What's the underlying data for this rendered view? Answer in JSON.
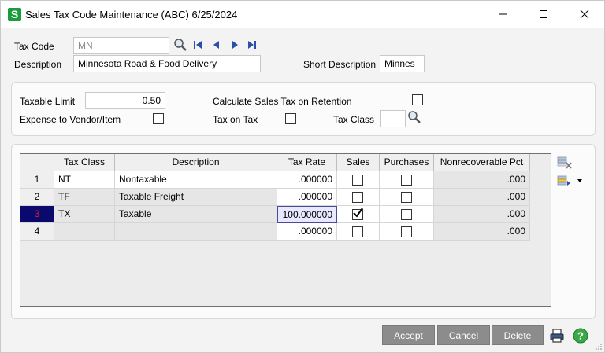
{
  "window": {
    "app_icon_letter": "S",
    "title": "Sales Tax Code Maintenance (ABC) 6/25/2024"
  },
  "header": {
    "tax_code_label": "Tax Code",
    "tax_code_value": "MN",
    "description_label": "Description",
    "description_value": "Minnesota Road & Food Delivery",
    "short_description_label": "Short Description",
    "short_description_value": "Minnes"
  },
  "options": {
    "taxable_limit_label": "Taxable Limit",
    "taxable_limit_value": "0.50",
    "calc_on_retention_label": "Calculate Sales Tax on Retention",
    "expense_to_vendor_label": "Expense to Vendor/Item",
    "tax_on_tax_label": "Tax on Tax",
    "tax_class_label": "Tax Class",
    "tax_class_value": ""
  },
  "grid": {
    "columns": [
      "Tax Class",
      "Description",
      "Tax Rate",
      "Sales",
      "Purchases",
      "Nonrecoverable Pct"
    ],
    "rows": [
      {
        "num": "1",
        "tax_class": "NT",
        "description": "Nontaxable",
        "tax_rate": ".000000",
        "sales": false,
        "purchases": false,
        "nonrecoverable": ".000"
      },
      {
        "num": "2",
        "tax_class": "TF",
        "description": "Taxable Freight",
        "tax_rate": ".000000",
        "sales": false,
        "purchases": false,
        "nonrecoverable": ".000"
      },
      {
        "num": "3",
        "tax_class": "TX",
        "description": "Taxable",
        "tax_rate": "100.000000",
        "sales": true,
        "purchases": false,
        "nonrecoverable": ".000"
      },
      {
        "num": "4",
        "tax_class": "",
        "description": "",
        "tax_rate": ".000000",
        "sales": false,
        "purchases": false,
        "nonrecoverable": ".000"
      }
    ]
  },
  "buttons": {
    "accept_first": "A",
    "accept_rest": "ccept",
    "cancel_first": "C",
    "cancel_rest": "ancel",
    "delete_first": "D",
    "delete_rest": "elete"
  },
  "colors": {
    "accent_green": "#1a9c3a",
    "nav_blue": "#2b4fa8",
    "button_gray": "#8c8c8c"
  },
  "icons": [
    "lookup-icon",
    "first-record-icon",
    "previous-record-icon",
    "next-record-icon",
    "last-record-icon",
    "delete-row-icon",
    "insert-row-icon",
    "print-icon",
    "help-icon"
  ]
}
